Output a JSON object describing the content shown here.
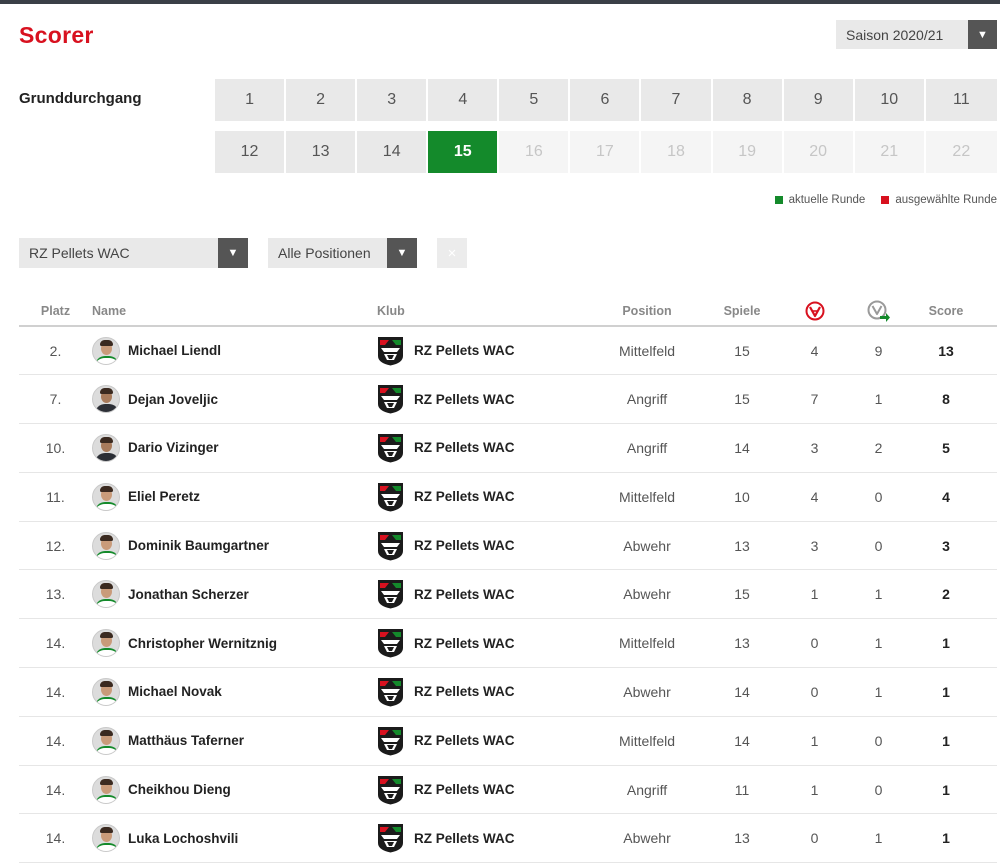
{
  "page": {
    "title": "Scorer"
  },
  "season_select": {
    "value": "Saison 2020/21"
  },
  "rounds": {
    "label": "Grunddurchgang",
    "row1": [
      "1",
      "2",
      "3",
      "4",
      "5",
      "6",
      "7",
      "8",
      "9",
      "10",
      "11"
    ],
    "row2": [
      "12",
      "13",
      "14",
      "15",
      "16",
      "17",
      "18",
      "19",
      "20",
      "21",
      "22"
    ],
    "current": "15",
    "last_played": "15"
  },
  "legend": {
    "current": "aktuelle Runde",
    "selected": "ausgewählte Runde"
  },
  "filters": {
    "club": "RZ Pellets WAC",
    "position": "Alle Positionen",
    "reset": "×"
  },
  "colors": {
    "brand_red": "#d8111f",
    "current_green": "#148a2b"
  },
  "table": {
    "headers": {
      "rank": "Platz",
      "name": "Name",
      "club": "Klub",
      "position": "Position",
      "games": "Spiele",
      "goals_icon": "ball-icon",
      "assists_icon": "assist-icon",
      "score": "Score"
    },
    "rows": [
      {
        "rank": "2.",
        "name": "Michael Liendl",
        "club": "RZ Pellets WAC",
        "position": "Mittelfeld",
        "games": "15",
        "goals": "4",
        "assists": "9",
        "score": "13"
      },
      {
        "rank": "7.",
        "name": "Dejan Joveljic",
        "club": "RZ Pellets WAC",
        "position": "Angriff",
        "games": "15",
        "goals": "7",
        "assists": "1",
        "score": "8"
      },
      {
        "rank": "10.",
        "name": "Dario Vizinger",
        "club": "RZ Pellets WAC",
        "position": "Angriff",
        "games": "14",
        "goals": "3",
        "assists": "2",
        "score": "5"
      },
      {
        "rank": "11.",
        "name": "Eliel Peretz",
        "club": "RZ Pellets WAC",
        "position": "Mittelfeld",
        "games": "10",
        "goals": "4",
        "assists": "0",
        "score": "4"
      },
      {
        "rank": "12.",
        "name": "Dominik Baumgartner",
        "club": "RZ Pellets WAC",
        "position": "Abwehr",
        "games": "13",
        "goals": "3",
        "assists": "0",
        "score": "3"
      },
      {
        "rank": "13.",
        "name": "Jonathan Scherzer",
        "club": "RZ Pellets WAC",
        "position": "Abwehr",
        "games": "15",
        "goals": "1",
        "assists": "1",
        "score": "2"
      },
      {
        "rank": "14.",
        "name": "Christopher Wernitznig",
        "club": "RZ Pellets WAC",
        "position": "Mittelfeld",
        "games": "13",
        "goals": "0",
        "assists": "1",
        "score": "1"
      },
      {
        "rank": "14.",
        "name": "Michael Novak",
        "club": "RZ Pellets WAC",
        "position": "Abwehr",
        "games": "14",
        "goals": "0",
        "assists": "1",
        "score": "1"
      },
      {
        "rank": "14.",
        "name": "Matthäus Taferner",
        "club": "RZ Pellets WAC",
        "position": "Mittelfeld",
        "games": "14",
        "goals": "1",
        "assists": "0",
        "score": "1"
      },
      {
        "rank": "14.",
        "name": "Cheikhou Dieng",
        "club": "RZ Pellets WAC",
        "position": "Angriff",
        "games": "11",
        "goals": "1",
        "assists": "0",
        "score": "1"
      },
      {
        "rank": "14.",
        "name": "Luka Lochoshvili",
        "club": "RZ Pellets WAC",
        "position": "Abwehr",
        "games": "13",
        "goals": "0",
        "assists": "1",
        "score": "1"
      }
    ]
  }
}
